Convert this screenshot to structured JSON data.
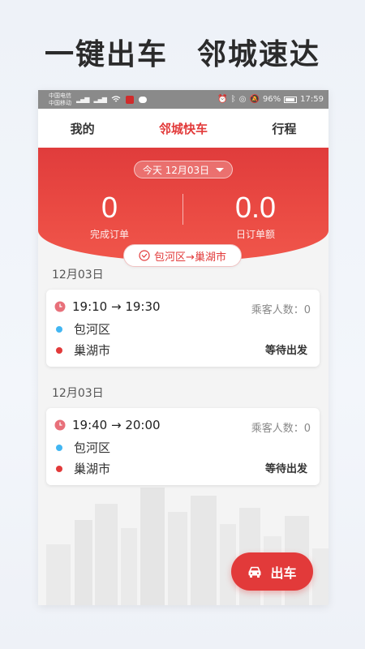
{
  "headline": {
    "part1": "一键出车",
    "part2": "邻城速达"
  },
  "statusbar": {
    "carrier1": "中国电信",
    "carrier2": "中国移动",
    "battery": "96%",
    "time": "17:59"
  },
  "tabs": [
    {
      "label": "我的",
      "active": false
    },
    {
      "label": "邻城快车",
      "active": true
    },
    {
      "label": "行程",
      "active": false
    }
  ],
  "summary": {
    "date_label": "今天 12月03日",
    "completed_orders": "0",
    "completed_orders_label": "完成订单",
    "daily_amount": "0.0",
    "daily_amount_label": "日订单额",
    "route": "包河区→巢湖市"
  },
  "orders": [
    {
      "date": "12月03日",
      "time": "19:10 → 19:30",
      "passengers": "乘客人数：0",
      "from": "包河区",
      "to": "巢湖市",
      "status": "等待出发"
    },
    {
      "date": "12月03日",
      "time": "19:40 → 20:00",
      "passengers": "乘客人数：0",
      "from": "包河区",
      "to": "巢湖市",
      "status": "等待出发"
    }
  ],
  "depart_button": {
    "label": "出车"
  },
  "colors": {
    "accent": "#e23a3a",
    "origin_dot": "#42b6f2",
    "dest_dot": "#e23a3a"
  }
}
